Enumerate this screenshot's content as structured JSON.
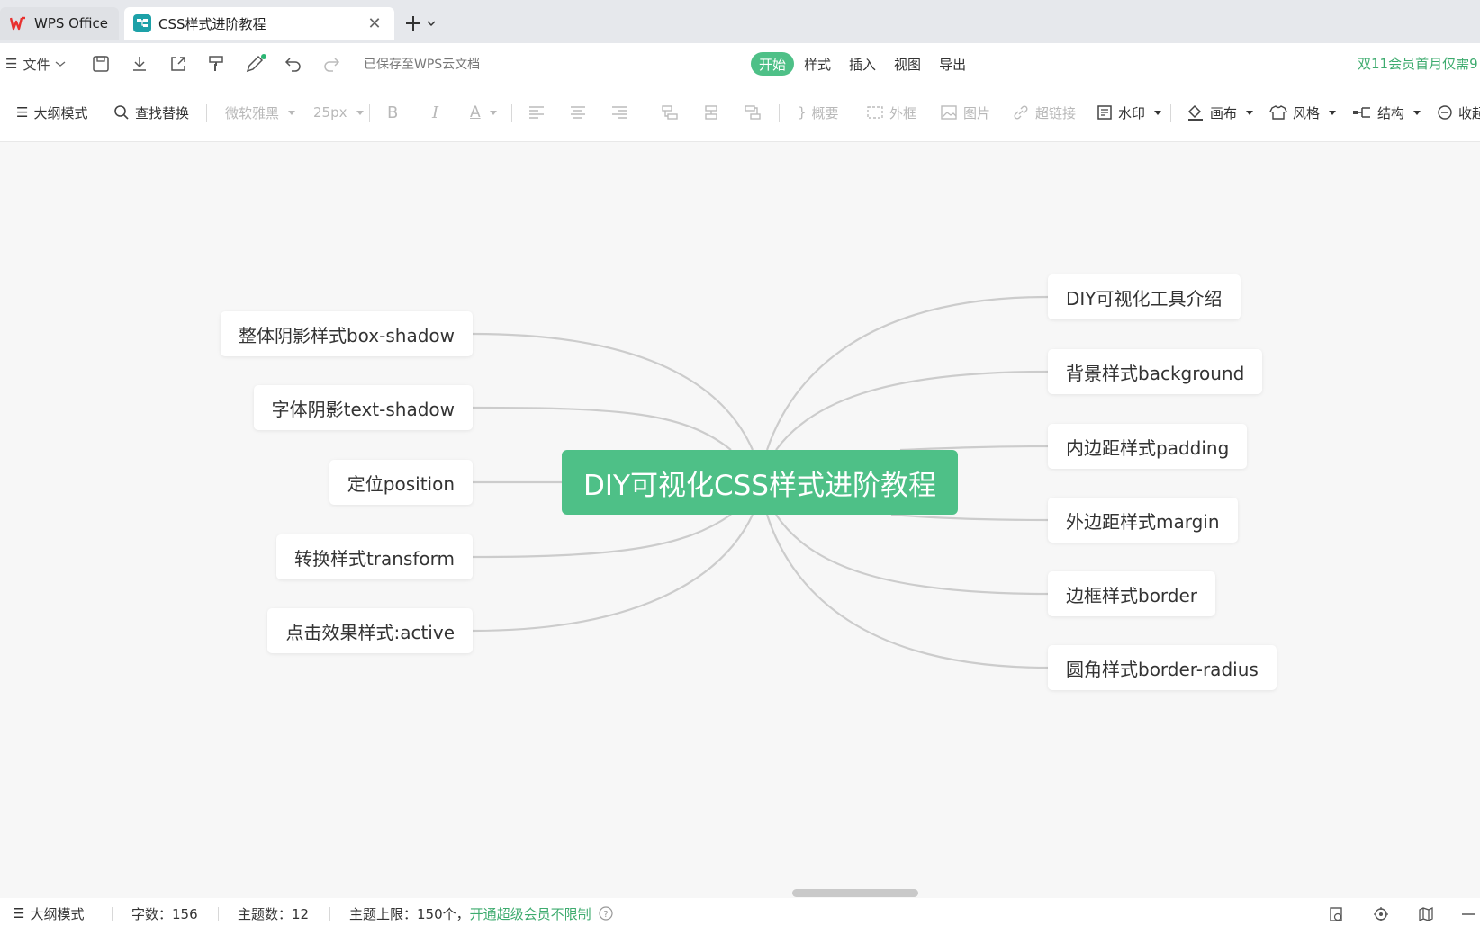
{
  "tabs": {
    "inactive_label": "WPS Office",
    "active_label": "CSS样式进阶教程"
  },
  "toolbar1": {
    "file_label": "文件",
    "saved_status": "已保存至WPS云文档",
    "menu": [
      "开始",
      "样式",
      "插入",
      "视图",
      "导出"
    ],
    "active_menu": "开始",
    "promo": "双11会员首月仅需9"
  },
  "toolbar2": {
    "outline_mode": "大纲模式",
    "find_replace": "查找替换",
    "font_family": "微软雅黑",
    "font_size": "25px",
    "bold": "B",
    "italic": "I",
    "font_color": "A",
    "summary": "概要",
    "frame": "外框",
    "image": "图片",
    "hyperlink": "超链接",
    "watermark": "水印",
    "canvas": "画布",
    "style": "风格",
    "structure": "结构",
    "collapse": "收起"
  },
  "mindmap": {
    "root": "DIY可视化CSS样式进阶教程",
    "left": [
      "整体阴影样式box-shadow",
      "字体阴影text-shadow",
      "定位position",
      "转换样式transform",
      "点击效果样式:active"
    ],
    "right": [
      "DIY可视化工具介绍",
      "背景样式background",
      "内边距样式padding",
      "外边距样式margin",
      "边框样式border",
      "圆角样式border-radius"
    ]
  },
  "statusbar": {
    "outline_mode": "大纲模式",
    "word_count": "字数：156",
    "topic_count": "主题数：12",
    "topic_limit": "主题上限：150个，",
    "upgrade_link": "开通超级会员不限制"
  },
  "colors": {
    "accent": "#4ec087",
    "promo": "#3dab6e",
    "link_line": "#cccccc",
    "canvas_bg": "#f7f7f7"
  }
}
